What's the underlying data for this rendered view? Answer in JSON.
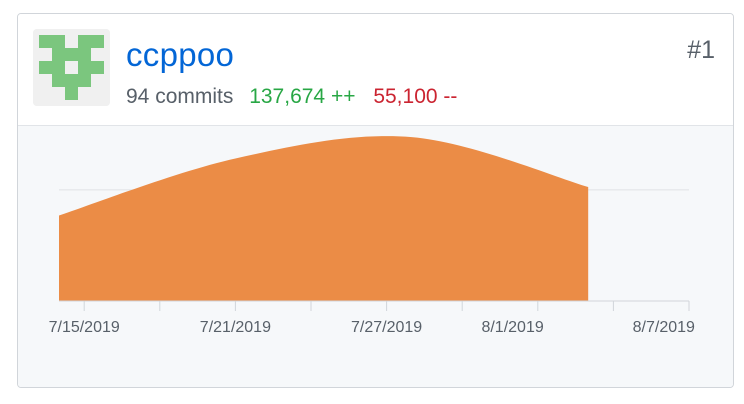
{
  "contributor": {
    "username": "ccppoo",
    "commits_label": "94 commits",
    "additions_label": "137,674 ++",
    "deletions_label": "55,100 --",
    "rank": "#1",
    "avatar_icon": "identicon-avatar",
    "colors": {
      "username": "#0366d6",
      "additions": "#28a745",
      "deletions": "#cb2431",
      "avatar": "#7bc67e"
    }
  },
  "chart_data": {
    "type": "area",
    "x": [
      "7/14/2019",
      "7/21/2019",
      "7/28/2019",
      "8/4/2019"
    ],
    "values": [
      12,
      20,
      23,
      16
    ],
    "x_ticks": [
      "7/15/2019",
      "7/21/2019",
      "7/27/2019",
      "8/1/2019",
      "8/7/2019"
    ],
    "xlim": [
      "7/14/2019",
      "8/8/2019"
    ],
    "ylim": [
      0,
      24
    ],
    "grid": true,
    "fill_color": "#eb8c46",
    "title": "",
    "xlabel": "",
    "ylabel": ""
  }
}
